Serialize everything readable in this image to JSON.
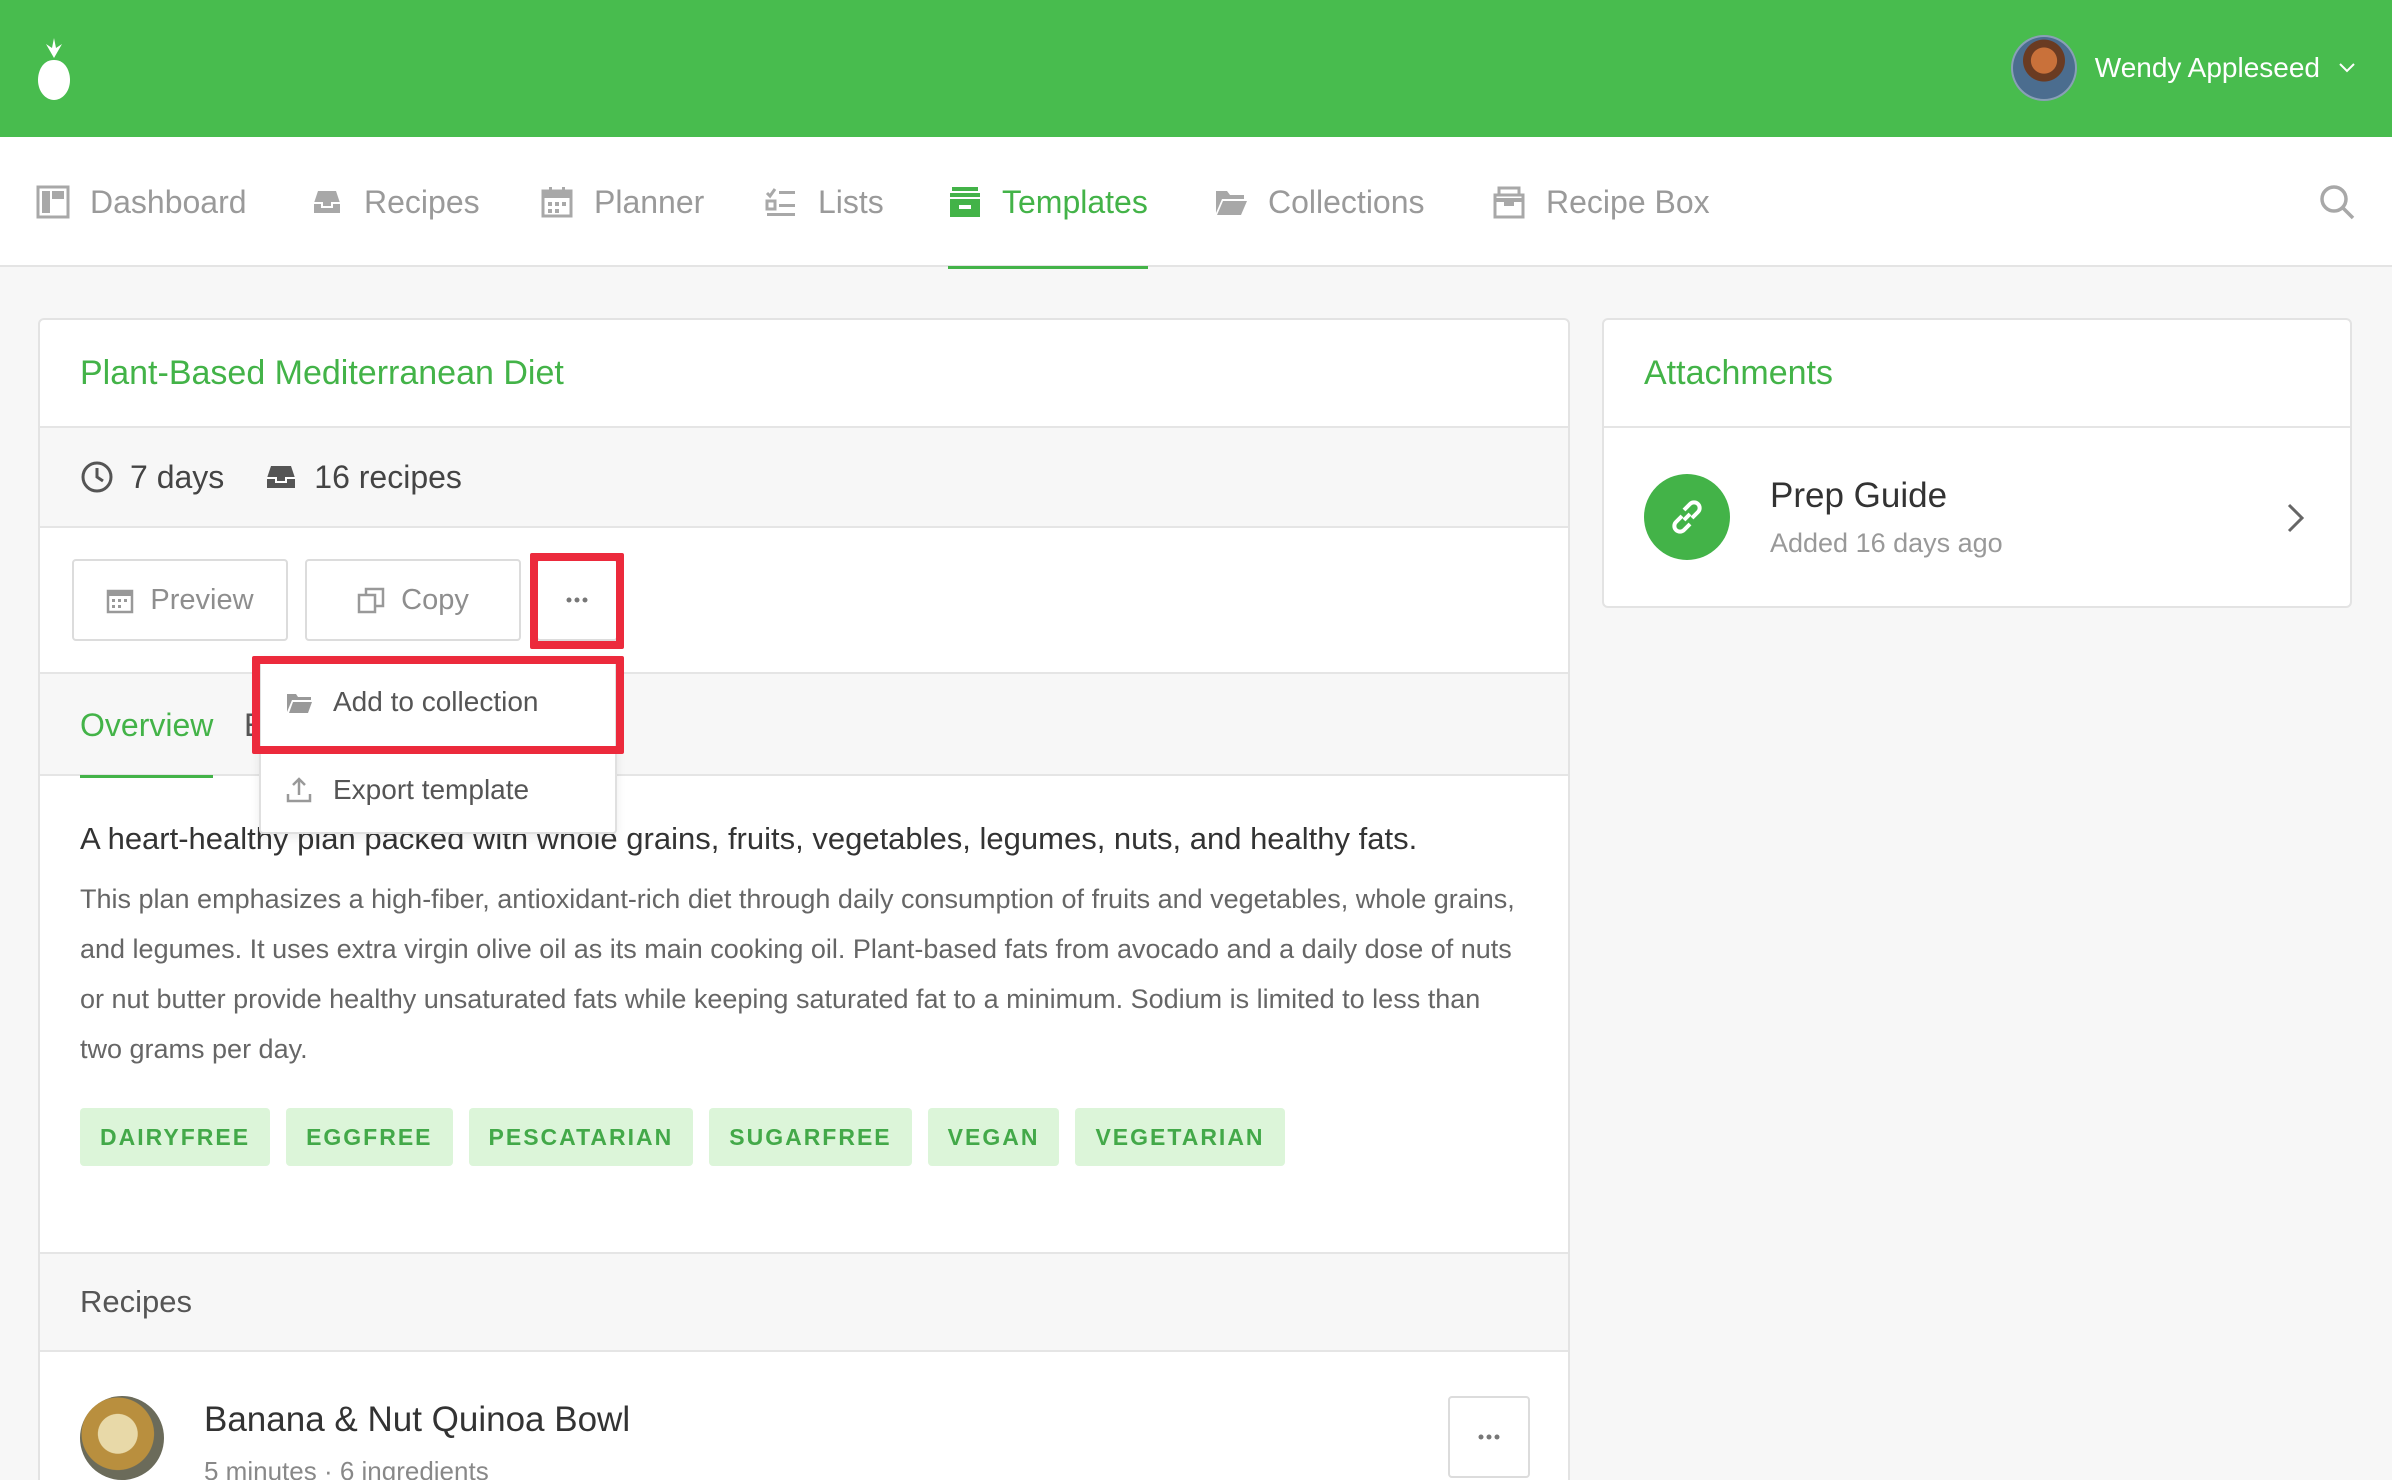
{
  "header": {
    "user_name": "Wendy Appleseed"
  },
  "nav": {
    "items": [
      {
        "label": "Dashboard",
        "icon": "dashboard-icon"
      },
      {
        "label": "Recipes",
        "icon": "inbox-tray-icon"
      },
      {
        "label": "Planner",
        "icon": "calendar-icon"
      },
      {
        "label": "Lists",
        "icon": "checklist-icon"
      },
      {
        "label": "Templates",
        "icon": "template-box-icon",
        "active": true
      },
      {
        "label": "Collections",
        "icon": "folder-icon"
      },
      {
        "label": "Recipe Box",
        "icon": "recipe-box-icon"
      }
    ]
  },
  "template": {
    "title": "Plant-Based Mediterranean Diet",
    "duration": "7 days",
    "recipe_count": "16 recipes",
    "actions": {
      "preview": "Preview",
      "copy": "Copy"
    },
    "menu": {
      "add_to_collection": "Add to collection",
      "export_template": "Export template"
    },
    "tabs": {
      "overview": "Overview",
      "partial_second": "E"
    },
    "summary": "A heart-healthy plan packed with whole grains, fruits, vegetables, legumes, nuts, and healthy fats.",
    "description": "This plan emphasizes a high-fiber, antioxidant-rich diet through daily consumption of fruits and vegetables, whole grains, and legumes. It uses extra virgin olive oil as its main cooking oil. Plant-based fats from avocado and a daily dose of nuts or nut butter provide healthy unsaturated fats while keeping saturated fat to a minimum. Sodium is limited to less than two grams per day.",
    "tags": [
      "DAIRYFREE",
      "EGGFREE",
      "PESCATARIAN",
      "SUGARFREE",
      "VEGAN",
      "VEGETARIAN"
    ]
  },
  "recipes": {
    "heading": "Recipes",
    "items": [
      {
        "name": "Banana & Nut Quinoa Bowl",
        "meta": "5 minutes · 6 ingredients"
      }
    ]
  },
  "attachments": {
    "heading": "Attachments",
    "items": [
      {
        "name": "Prep Guide",
        "added": "Added 16 days ago"
      }
    ]
  },
  "colors": {
    "brand_green": "#48bc4e",
    "accent_green": "#43b348",
    "highlight_red": "#ec2a3c",
    "tag_bg": "#dcf5d9"
  }
}
